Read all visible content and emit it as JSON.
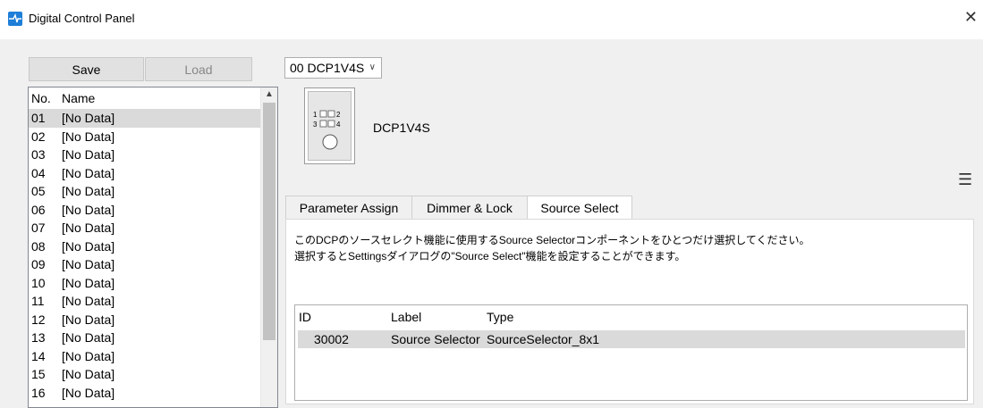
{
  "window": {
    "title": "Digital Control Panel"
  },
  "toolbar": {
    "save_label": "Save",
    "load_label": "Load"
  },
  "list": {
    "headers": {
      "no": "No.",
      "name": "Name"
    },
    "rows": [
      {
        "no": "01",
        "name": "[No Data]"
      },
      {
        "no": "02",
        "name": "[No Data]"
      },
      {
        "no": "03",
        "name": "[No Data]"
      },
      {
        "no": "04",
        "name": "[No Data]"
      },
      {
        "no": "05",
        "name": "[No Data]"
      },
      {
        "no": "06",
        "name": "[No Data]"
      },
      {
        "no": "07",
        "name": "[No Data]"
      },
      {
        "no": "08",
        "name": "[No Data]"
      },
      {
        "no": "09",
        "name": "[No Data]"
      },
      {
        "no": "10",
        "name": "[No Data]"
      },
      {
        "no": "11",
        "name": "[No Data]"
      },
      {
        "no": "12",
        "name": "[No Data]"
      },
      {
        "no": "13",
        "name": "[No Data]"
      },
      {
        "no": "14",
        "name": "[No Data]"
      },
      {
        "no": "15",
        "name": "[No Data]"
      },
      {
        "no": "16",
        "name": "[No Data]"
      }
    ],
    "selected_index": 0
  },
  "device": {
    "selector_value": "00 DCP1V4S",
    "name": "DCP1V4S",
    "button_labels": [
      "1",
      "2",
      "3",
      "4"
    ]
  },
  "tabs": [
    {
      "label": "Parameter Assign"
    },
    {
      "label": "Dimmer & Lock"
    },
    {
      "label": "Source Select"
    }
  ],
  "source_select": {
    "description_line1": "このDCPのソースセレクト機能に使用するSource Selectorコンポーネントをひとつだけ選択してください。",
    "description_line2": "選択するとSettingsダイアログの\"Source Select\"機能を設定することができます。",
    "table": {
      "headers": {
        "id": "ID",
        "label": "Label",
        "type": "Type"
      },
      "rows": [
        {
          "id": "30002",
          "label": "Source Selector",
          "type": "SourceSelector_8x1"
        }
      ]
    }
  },
  "colors": {
    "app_icon": "#1e7ed8",
    "selection": "#dadada"
  }
}
